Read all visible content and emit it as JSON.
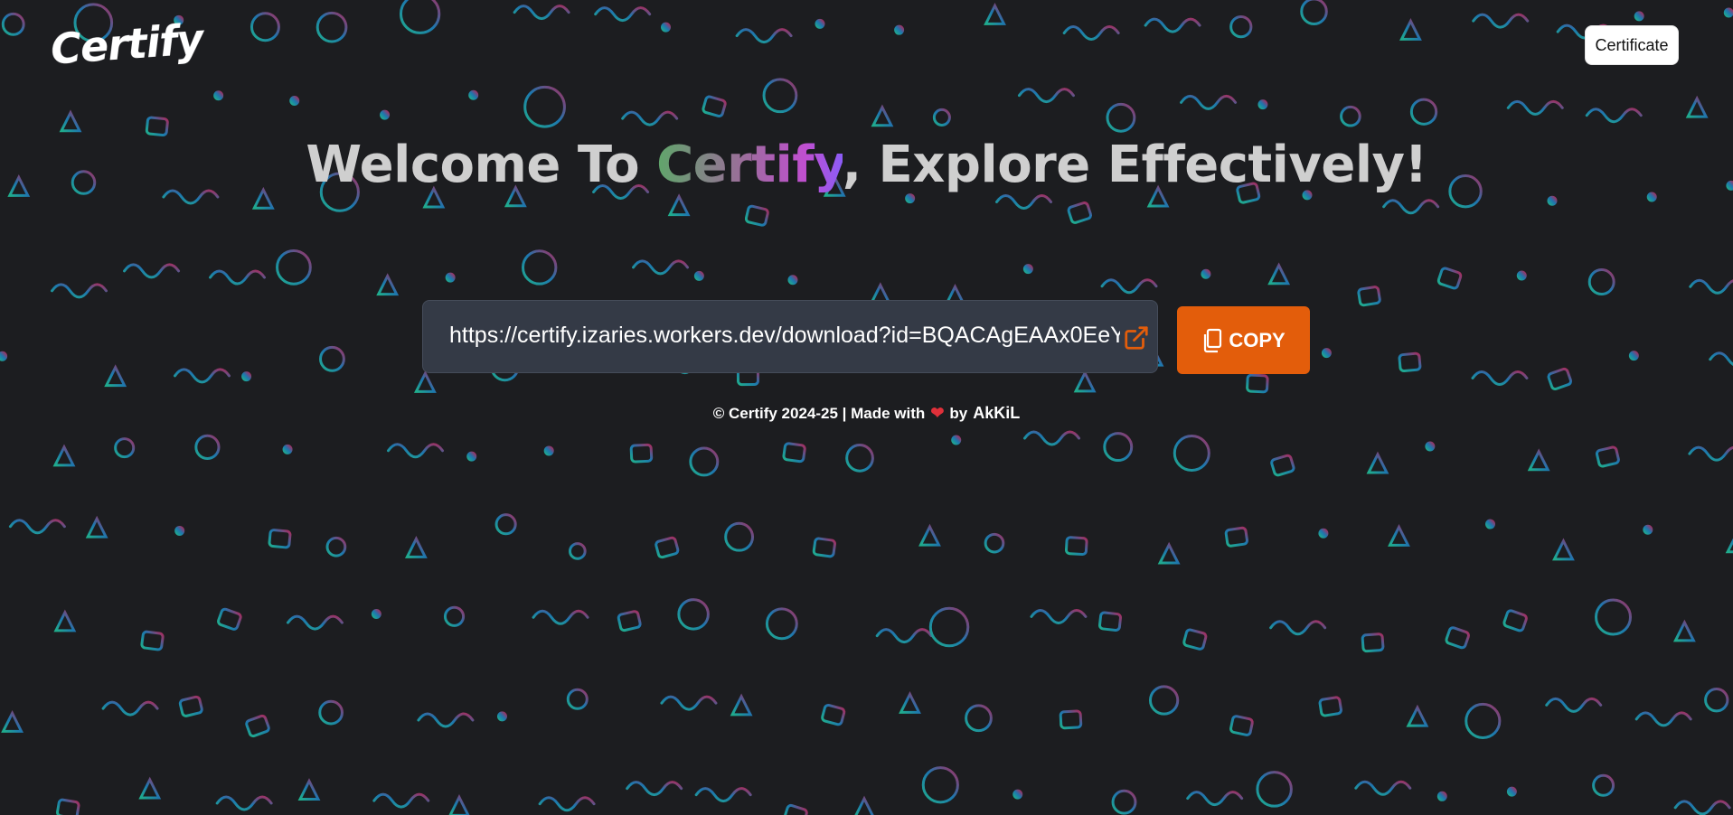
{
  "header": {
    "logo_text": "Certify",
    "certificate_button": "Certificate"
  },
  "hero": {
    "title_prefix": "Welcome To ",
    "title_brand": "Certify",
    "title_suffix": ", Explore Effectively!"
  },
  "link": {
    "url": "https://certify.izaries.workers.dev/download?id=BQACAgEAAx0EeY"
  },
  "actions": {
    "copy_label": "COPY"
  },
  "footer": {
    "copyright": "© Certify 2024-25 | Made with",
    "heart": "❤",
    "by": "by",
    "author": "AkKiL"
  },
  "icons": {
    "external_link": "external-link-icon",
    "copy": "copy-icon",
    "heart": "heart-icon"
  },
  "colors": {
    "background": "#1c1d20",
    "copy_button": "#e35d0b",
    "url_box": "#343a46",
    "pattern_start": "#22c9a0",
    "pattern_mid": "#1e88c9",
    "pattern_end": "#c2306a"
  }
}
